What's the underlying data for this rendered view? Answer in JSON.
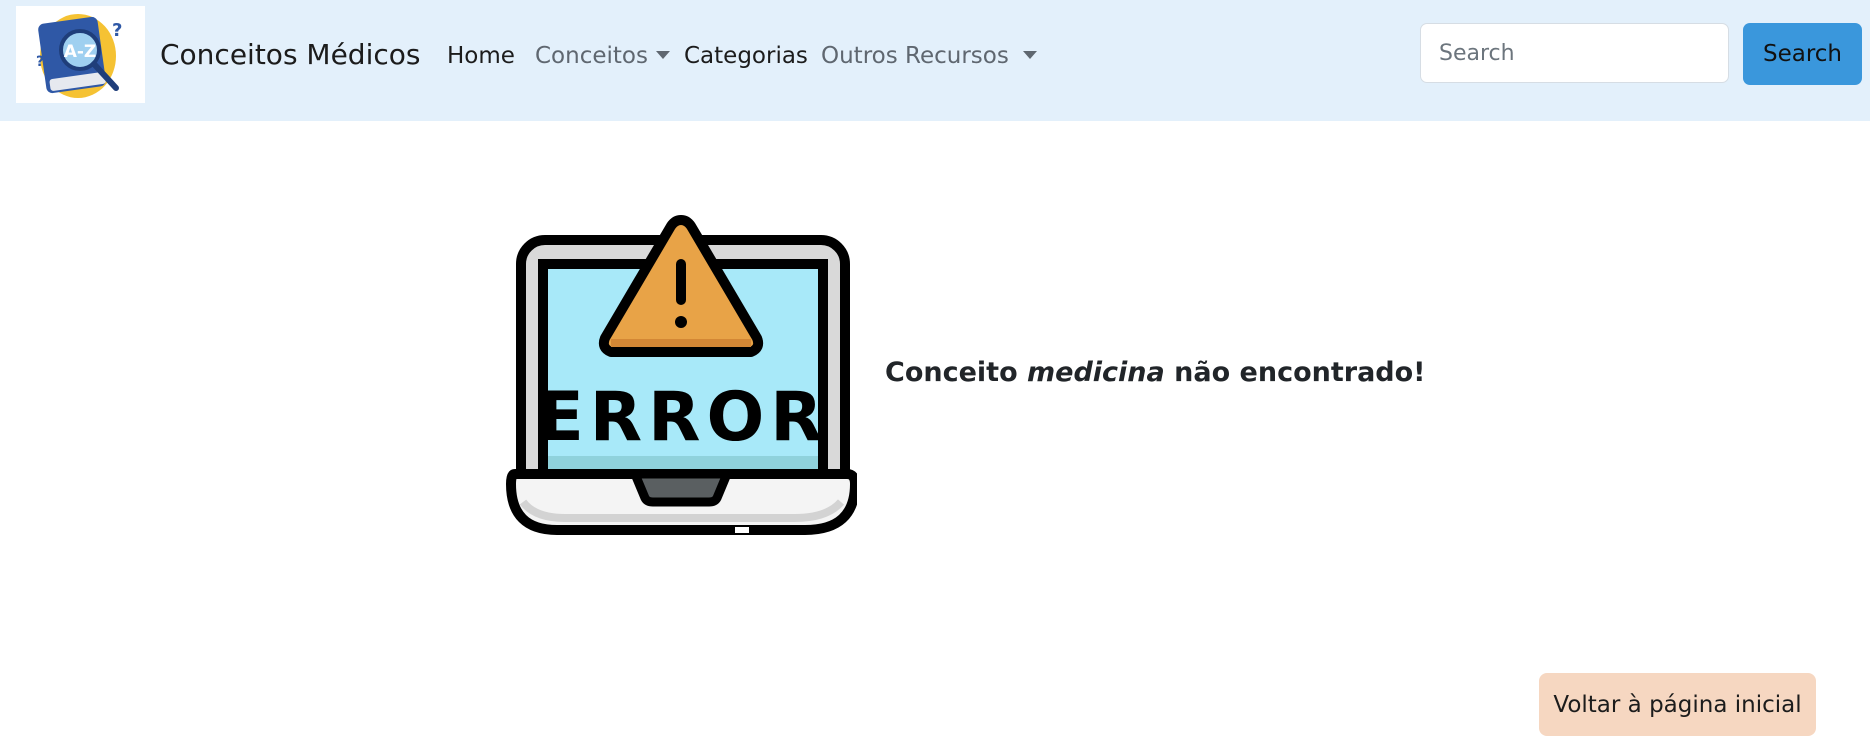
{
  "navbar": {
    "logo_icon": "medical-dictionary-logo-icon",
    "brand": "Conceitos Médicos",
    "items": [
      {
        "label": "Home",
        "dropdown": false
      },
      {
        "label": "Conceitos",
        "dropdown": true
      },
      {
        "label": "Categorias",
        "dropdown": false
      },
      {
        "label": "Outros Recursos",
        "dropdown": true
      }
    ],
    "search": {
      "placeholder": "Search",
      "value": "",
      "button_label": "Search"
    }
  },
  "main": {
    "illustration_icon": "laptop-error-warning-icon",
    "illustration_text": "ERROR",
    "message": {
      "prefix": "Conceito ",
      "term": "medicina",
      "suffix": " não encontrado!"
    },
    "home_button_label": "Voltar à página inicial"
  },
  "colors": {
    "navbar_bg": "#e3f0fb",
    "search_button": "#3a97dc",
    "home_button": "#f6d7c1",
    "warning_orange": "#e8a347",
    "screen_blue": "#a8e9f9"
  }
}
